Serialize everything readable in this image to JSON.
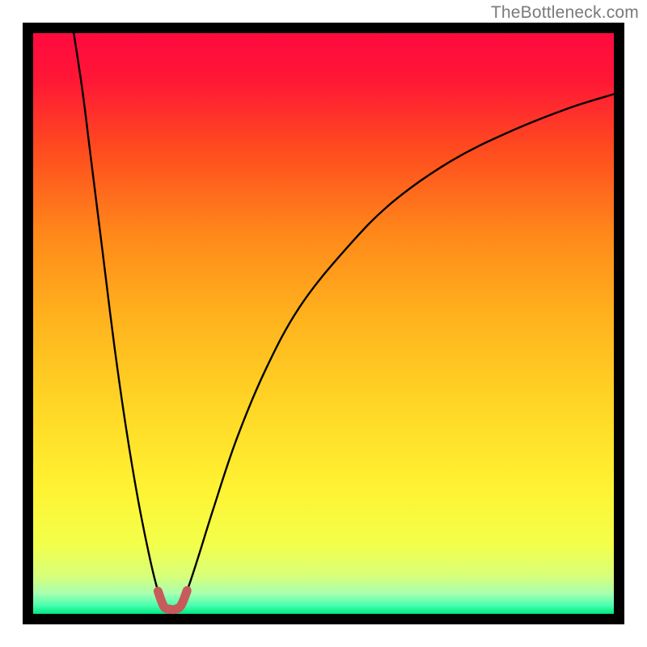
{
  "watermark": "TheBottleneck.com",
  "chart_data": {
    "type": "line",
    "title": "",
    "xlabel": "",
    "ylabel": "",
    "xlim": [
      0,
      100
    ],
    "ylim": [
      0,
      100
    ],
    "gradient_stops": [
      {
        "offset": 0.0,
        "color": "#ff0a3f"
      },
      {
        "offset": 0.08,
        "color": "#ff1736"
      },
      {
        "offset": 0.2,
        "color": "#ff4b1f"
      },
      {
        "offset": 0.35,
        "color": "#ff8a1a"
      },
      {
        "offset": 0.5,
        "color": "#ffb51e"
      },
      {
        "offset": 0.65,
        "color": "#ffd826"
      },
      {
        "offset": 0.78,
        "color": "#fff232"
      },
      {
        "offset": 0.88,
        "color": "#f3ff4a"
      },
      {
        "offset": 0.935,
        "color": "#d8ff7a"
      },
      {
        "offset": 0.965,
        "color": "#a8ffb0"
      },
      {
        "offset": 0.985,
        "color": "#4cffb0"
      },
      {
        "offset": 1.0,
        "color": "#00e882"
      }
    ],
    "series": [
      {
        "name": "curve",
        "points": [
          {
            "x": 7.0,
            "y": 100.0
          },
          {
            "x": 8.5,
            "y": 90.0
          },
          {
            "x": 10.0,
            "y": 78.0
          },
          {
            "x": 12.0,
            "y": 62.0
          },
          {
            "x": 14.0,
            "y": 46.0
          },
          {
            "x": 16.0,
            "y": 32.0
          },
          {
            "x": 18.0,
            "y": 20.0
          },
          {
            "x": 20.0,
            "y": 10.0
          },
          {
            "x": 21.5,
            "y": 4.0
          },
          {
            "x": 23.0,
            "y": 1.0
          },
          {
            "x": 25.0,
            "y": 1.0
          },
          {
            "x": 26.5,
            "y": 4.0
          },
          {
            "x": 28.5,
            "y": 10.0
          },
          {
            "x": 31.0,
            "y": 18.0
          },
          {
            "x": 35.0,
            "y": 30.0
          },
          {
            "x": 40.0,
            "y": 42.0
          },
          {
            "x": 46.0,
            "y": 53.0
          },
          {
            "x": 54.0,
            "y": 63.0
          },
          {
            "x": 62.0,
            "y": 71.0
          },
          {
            "x": 72.0,
            "y": 78.0
          },
          {
            "x": 82.0,
            "y": 83.0
          },
          {
            "x": 92.0,
            "y": 87.0
          },
          {
            "x": 100.0,
            "y": 89.5
          }
        ]
      }
    ],
    "highlight": {
      "name": "bottleneck-marker",
      "color": "#c75a5a",
      "points": [
        {
          "x": 21.5,
          "y": 3.9
        },
        {
          "x": 22.5,
          "y": 1.3
        },
        {
          "x": 23.5,
          "y": 0.8
        },
        {
          "x": 24.5,
          "y": 0.8
        },
        {
          "x": 25.5,
          "y": 1.5
        },
        {
          "x": 26.5,
          "y": 4.0
        }
      ]
    }
  }
}
